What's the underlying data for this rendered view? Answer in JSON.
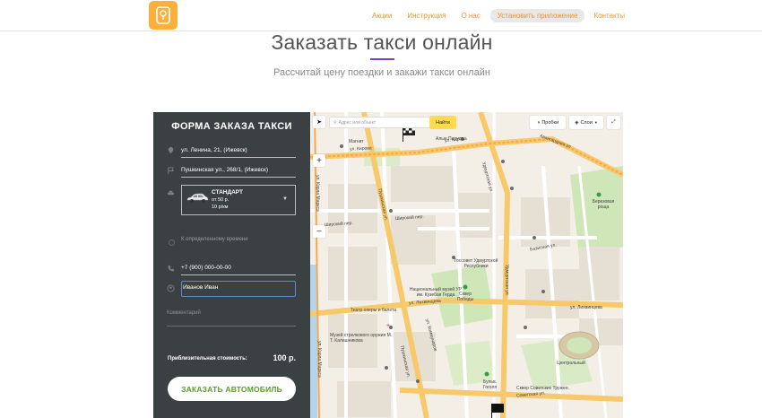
{
  "nav": {
    "items": [
      "Акции",
      "Инструкция",
      "О нас"
    ],
    "highlighted": "Установить приложение",
    "last": "Контакты"
  },
  "hero": {
    "title": "Заказать такси онлайн",
    "subtitle": "Рассчитай цену поездки и закажи такси онлайн"
  },
  "form": {
    "title": "ФОРМА ЗАКАЗА ТАКСИ",
    "from": "ул. Ленина, 21, (Ижевск)",
    "to": "Пушкинская ул., 268/1, (Ижевск)",
    "car": {
      "name": "СТАНДАРТ",
      "price": "от 50 р.",
      "per_km": "10 р/км"
    },
    "schedule_label": "К определенному времени",
    "phone": "+7 (900) 000-00-00",
    "name": "Иванов Иван",
    "comment_placeholder": "Комментарий",
    "cost_label": "Приблизительная стоимость:",
    "cost_value": "100 р.",
    "order_button": "ЗАКАЗАТЬ АВТОМОБИЛЬ"
  },
  "map": {
    "search_placeholder": "Адрес или объект",
    "find_button": "Найти",
    "traffic_button": "Пробки",
    "layers_button": "Слои",
    "zoom_in": "+",
    "zoom_out": "−",
    "labels": {
      "kirova": "ул. Кирова",
      "pushkinskaya": "Пушкинская ул.",
      "udmurtskaya": "Удмуртская ул.",
      "karla_marksa": "ул. Карла Маркса",
      "lihvintseva": "ул. Лихвинцева",
      "shirokiy": "Широкий пер.",
      "avangardnaya": "Авангардная ул.",
      "bazisnaya": "Базисная ул.",
      "sovetskaya": "Советская ул.",
      "gos_sovet": "Госсовет Удмуртской Республики",
      "museum": "Национальный музей УР им. Кузебая Герда",
      "theatre": "Театр оперы и балета",
      "museum2": "Музей стрелкового оружия М. Т. Калашникова",
      "square": "Сквер Победы",
      "beryozovaya": "Березовая роща",
      "mag": "Магнит",
      "alye": "Алые Паруса",
      "central": "Центральный",
      "bulvar": "Бульв. Гоголя",
      "lihv2": "ул. Лихвинцева",
      "sovet_square": "Сквер Советских Тружен.",
      "vozdushnaya": "Воздушная ул.",
      "lenina_label": "ул. Коммунаров"
    }
  }
}
